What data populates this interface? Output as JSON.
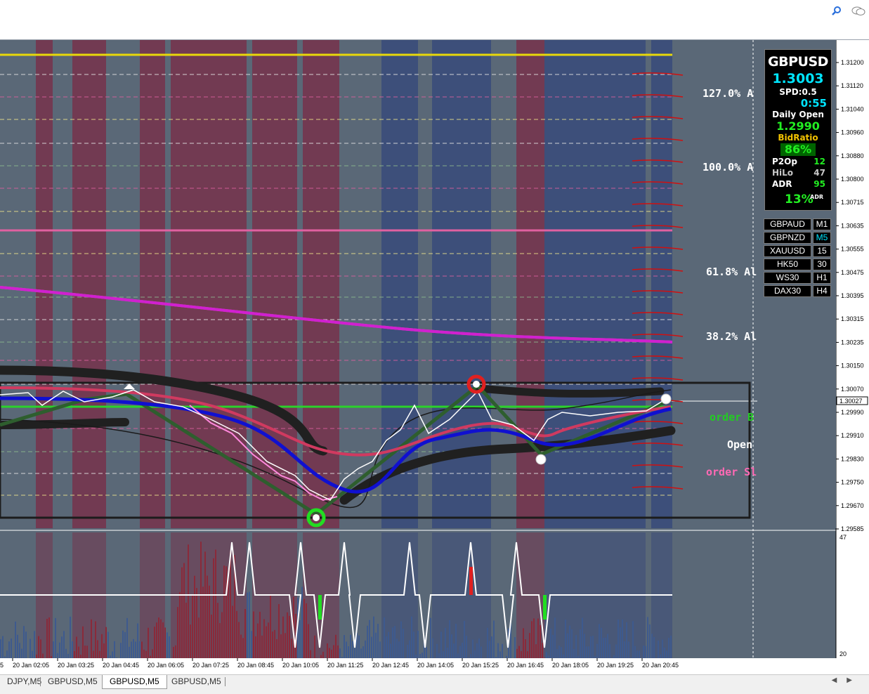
{
  "chart_data": {
    "type": "line",
    "symbol": "GBPUSD",
    "timeframe": "M5",
    "x_labels": [
      "20 Jan 02:05",
      "20 Jan 03:25",
      "20 Jan 04:45",
      "20 Jan 06:05",
      "20 Jan 07:25",
      "20 Jan 08:45",
      "20 Jan 10:05",
      "20 Jan 11:25",
      "20 Jan 12:45",
      "20 Jan 14:05",
      "20 Jan 15:25",
      "20 Jan 16:45",
      "20 Jan 18:05",
      "20 Jan 19:25",
      "20 Jan 20:45"
    ],
    "x_first_partial": "5",
    "y_ticks": [
      "1.31200",
      "1.31120",
      "1.31040",
      "1.30960",
      "1.30880",
      "1.30800",
      "1.30715",
      "1.30635",
      "1.30555",
      "1.30475",
      "1.30395",
      "1.30315",
      "1.30235",
      "1.30150",
      "1.30070",
      "1.29990",
      "1.29910",
      "1.29830",
      "1.29750",
      "1.29670",
      "1.29585"
    ],
    "current_price": "1.30027",
    "fib_labels": [
      {
        "text": "127.0% A",
        "price": 1.3106
      },
      {
        "text": "100.0% A",
        "price": 1.3083
      },
      {
        "text": "61.8% Al",
        "price": 1.305
      },
      {
        "text": "38.2% Al",
        "price": 1.303
      }
    ],
    "order_labels": [
      {
        "text": "order B",
        "color": "#22cc22",
        "price": 1.2998
      },
      {
        "text": "Open",
        "color": "#ffffff",
        "price": 1.299
      },
      {
        "text": "order Sl",
        "color": "#ff69b4",
        "price": 1.2981
      }
    ],
    "indicator_scale": {
      "max": "47",
      "min": "20"
    }
  },
  "info_panel": {
    "symbol": "GBPUSD",
    "bid": "1.3003",
    "spread": "SPD:0.5",
    "timer": "0:55",
    "daily_open_label": "Daily Open",
    "daily_open": "1.2990",
    "bid_ratio_label": "BidRatio",
    "bid_ratio": "86%",
    "p2op_label": "P2Op",
    "p2op": "12",
    "hilo_label": "HiLo",
    "hilo": "47",
    "adr_label": "ADR",
    "adr": "95",
    "adr_pct": "13%",
    "adr_suffix": "ADR"
  },
  "symbol_buttons": [
    {
      "symbol": "GBPAUD",
      "tf": "M1"
    },
    {
      "symbol": "GBPNZD",
      "tf": "M5"
    },
    {
      "symbol": "XAUUSD",
      "tf": "15"
    },
    {
      "symbol": "HK50",
      "tf": "30"
    },
    {
      "symbol": "WS30",
      "tf": "H1"
    },
    {
      "symbol": "DAX30",
      "tf": "H4"
    }
  ],
  "tabs": [
    "DJPY,M5",
    "GBPUSD,M5",
    "GBPUSD,M5",
    "GBPUSD,M5"
  ],
  "active_tab_index": 2,
  "colors": {
    "chart_bg": "#5a6877",
    "blue_zone": "#3d4f7a",
    "red_zone": "#723a52",
    "accent_yellow": "#e8d80a",
    "pink_line": "#e060a0",
    "magenta_ma": "#d020d0"
  },
  "icons": {
    "search": "search-icon",
    "chat": "chat-icon",
    "scroll_left": "arrow-left-icon",
    "scroll_right": "arrow-right-icon"
  }
}
